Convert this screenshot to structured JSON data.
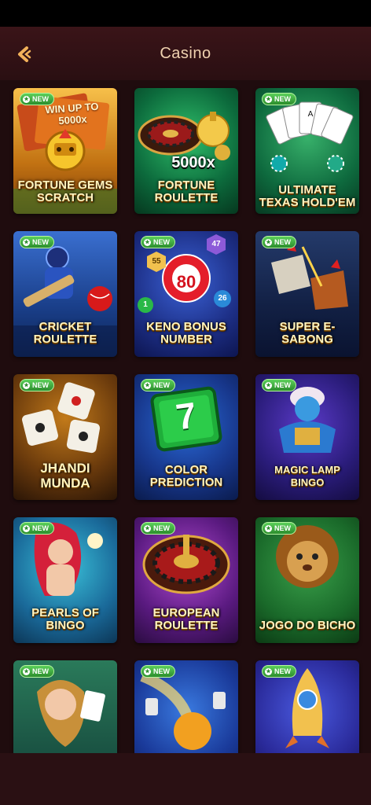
{
  "header": {
    "title": "Casino"
  },
  "badge": {
    "label": "NEW"
  },
  "games": [
    {
      "name": "FORTUNE GEMS SCRATCH",
      "art_text": "WIN UP TO 5000x",
      "new": true
    },
    {
      "name": "FORTUNE ROULETTE",
      "art_text": "5000x",
      "new": false
    },
    {
      "name": "ULTIMATE TEXAS HOLD'EM",
      "art_text": "",
      "new": true
    },
    {
      "name": "CRICKET ROULETTE",
      "art_text": "",
      "new": true
    },
    {
      "name": "KENO BONUS NUMBER",
      "art_text": "80",
      "new": true
    },
    {
      "name": "SUPER E-SABONG",
      "art_text": "",
      "new": true
    },
    {
      "name": "JHANDI MUNDA",
      "art_text": "",
      "new": true
    },
    {
      "name": "COLOR PREDICTION",
      "art_text": "7",
      "new": true
    },
    {
      "name": "MAGIC LAMP BINGO",
      "art_text": "",
      "new": true
    },
    {
      "name": "PEARLS OF BINGO",
      "art_text": "",
      "new": true
    },
    {
      "name": "EUROPEAN ROULETTE",
      "art_text": "",
      "new": true
    },
    {
      "name": "JOGO DO BICHO",
      "art_text": "",
      "new": true
    },
    {
      "name": "",
      "art_text": "",
      "new": true
    },
    {
      "name": "",
      "art_text": "",
      "new": true
    },
    {
      "name": "",
      "art_text": "",
      "new": true
    }
  ],
  "keno_balls": [
    "55",
    "47",
    "1",
    "26"
  ],
  "icons": {
    "back": "chevron-left-icon",
    "badge": "star-icon"
  },
  "colors": {
    "header_text": "#f0d2b0",
    "badge_green": "#3aa83a",
    "accent_gold": "#f2c14e"
  }
}
